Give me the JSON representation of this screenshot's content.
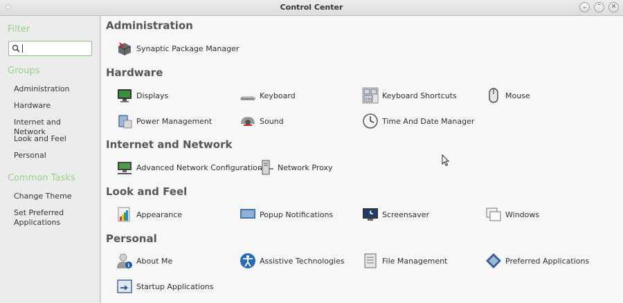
{
  "window": {
    "title": "Control Center"
  },
  "sidebar": {
    "filter_heading": "Filter",
    "search_value": "",
    "groups_heading": "Groups",
    "groups": [
      "Administration",
      "Hardware",
      "Internet and Network",
      "Look and Feel",
      "Personal"
    ],
    "tasks_heading": "Common Tasks",
    "tasks": [
      "Change Theme",
      "Set Preferred Applications"
    ]
  },
  "sections": [
    {
      "title": "Administration",
      "items": [
        {
          "label": "Synaptic Package Manager",
          "icon": "package-icon"
        }
      ]
    },
    {
      "title": "Hardware",
      "items": [
        {
          "label": "Displays",
          "icon": "display-icon"
        },
        {
          "label": "Keyboard",
          "icon": "keyboard-icon"
        },
        {
          "label": "Keyboard Shortcuts",
          "icon": "keyboard-shortcuts-icon"
        },
        {
          "label": "Mouse",
          "icon": "mouse-icon"
        },
        {
          "label": "Power Management",
          "icon": "power-icon"
        },
        {
          "label": "Sound",
          "icon": "sound-icon"
        },
        {
          "label": "Time And Date Manager",
          "icon": "clock-icon"
        }
      ]
    },
    {
      "title": "Internet and Network",
      "items": [
        {
          "label": "Advanced Network Configuration",
          "icon": "network-icon"
        },
        {
          "label": "Network Proxy",
          "icon": "proxy-icon"
        }
      ]
    },
    {
      "title": "Look and Feel",
      "items": [
        {
          "label": "Appearance",
          "icon": "appearance-icon"
        },
        {
          "label": "Popup Notifications",
          "icon": "notification-icon"
        },
        {
          "label": "Screensaver",
          "icon": "screensaver-icon"
        },
        {
          "label": "Windows",
          "icon": "windows-icon"
        }
      ]
    },
    {
      "title": "Personal",
      "items": [
        {
          "label": "About Me",
          "icon": "user-icon"
        },
        {
          "label": "Assistive Technologies",
          "icon": "accessibility-icon"
        },
        {
          "label": "File Management",
          "icon": "file-icon"
        },
        {
          "label": "Preferred Applications",
          "icon": "preferred-apps-icon"
        },
        {
          "label": "Startup Applications",
          "icon": "startup-icon"
        }
      ]
    }
  ],
  "colors": {
    "accent": "#9ccf8d",
    "background": "#f7f7f7",
    "sidebar": "#ececec"
  }
}
